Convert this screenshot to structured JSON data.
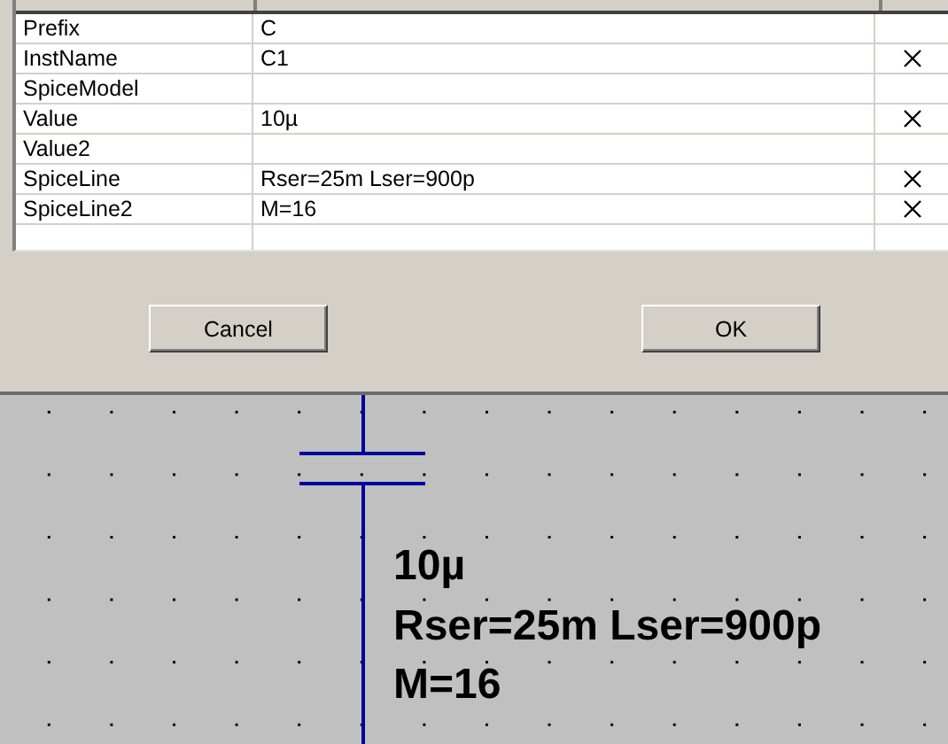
{
  "attributes": [
    {
      "attribute": "Prefix",
      "value": "C",
      "visible": false
    },
    {
      "attribute": "InstName",
      "value": "C1",
      "visible": true
    },
    {
      "attribute": "SpiceModel",
      "visible": false
    },
    {
      "attribute": "Value",
      "value": "10µ",
      "visible": true
    },
    {
      "attribute": "Value2",
      "visible": false
    },
    {
      "attribute": "SpiceLine",
      "value": "Rser=25m Lser=900p",
      "visible": true
    },
    {
      "attribute": "SpiceLine2",
      "value": "M=16",
      "visible": true
    }
  ],
  "buttons": [
    "Cancel",
    "OK"
  ],
  "schematic": {
    "labels": [
      "10µ",
      "Rser=25m Lser=900p",
      "M=16"
    ]
  }
}
